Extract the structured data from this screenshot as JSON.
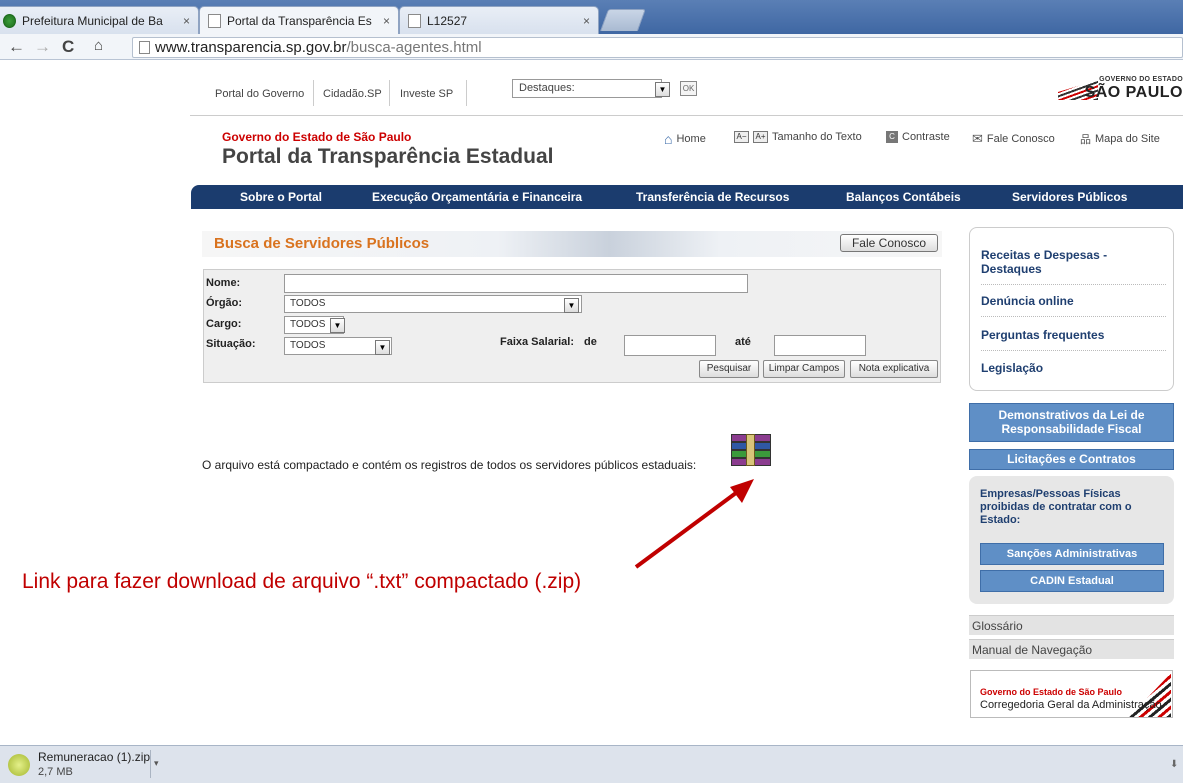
{
  "browser": {
    "tabs": [
      {
        "title": "Prefeitura Municipal de Ba",
        "close": "×"
      },
      {
        "title": "Portal da Transparência Es",
        "close": "×"
      },
      {
        "title": "L12527",
        "close": "×"
      }
    ],
    "url_host": "www.transparencia.sp.gov.br",
    "url_path": "/busca-agentes.html",
    "nav_icons": [
      "back-icon",
      "forward-icon",
      "reload-icon",
      "home-icon"
    ]
  },
  "govbar": {
    "links": [
      "Portal do Governo",
      "Cidadão.SP",
      "Investe SP"
    ],
    "destaques": "Destaques:",
    "ok_label": "OK",
    "logo_line1": "GOVERNO DO ESTADO",
    "logo_line2": "SÃO PAULO"
  },
  "header": {
    "gov_name": "Governo do Estado de São Paulo",
    "portal_name": "Portal da Transparência Estadual",
    "home": "Home",
    "a_minus": "A−",
    "a_plus": "A+",
    "text_size": "Tamanho do Texto",
    "contrast_icon": "C",
    "contrast": "Contraste",
    "contact": "Fale Conosco",
    "sitemap": "Mapa do Site"
  },
  "mainnav": [
    "Sobre o Portal",
    "Execução Orçamentária e Financeira",
    "Transferência de Recursos",
    "Balanços Contábeis",
    "Servidores Públicos"
  ],
  "search": {
    "title": "Busca de Servidores Públicos",
    "fale_button": "Fale Conosco",
    "nome_label": "Nome:",
    "nome_value": "",
    "orgao_label": "Órgão:",
    "orgao_value": "TODOS",
    "cargo_label": "Cargo:",
    "cargo_value": "TODOS",
    "situacao_label": "Situação:",
    "situacao_value": "TODOS",
    "faixa_label": "Faixa Salarial:",
    "de_label": "de",
    "ate_label": "até",
    "de_value": "",
    "ate_value": "",
    "btn_search": "Pesquisar",
    "btn_clear": "Limpar Campos",
    "btn_note": "Nota explicativa"
  },
  "download": {
    "text": "O arquivo está compactado e contém os registros de todos os servidores públicos estaduais:"
  },
  "annotation": "Link para fazer download de arquivo “.txt”  compactado (.zip)",
  "sidebar": {
    "items": [
      "Receitas e Despesas - Destaques",
      "Denúncia online",
      "Perguntas frequentes",
      "Legislação"
    ],
    "lrf": "Demonstrativos da Lei de Responsabilidade Fiscal",
    "licitacoes": "Licitações e Contratos",
    "empresas": "Empresas/Pessoas Físicas proibidas de contratar com o Estado:",
    "sancoes": "Sanções Administrativas",
    "cadin": "CADIN Estadual",
    "glossario": "Glossário",
    "manual": "Manual de Navegação",
    "corr_line1": "Governo do Estado de São Paulo",
    "corr_line2": "Corregedoria Geral da Administração"
  },
  "downloads_bar": {
    "file": "Remuneracao (1).zip",
    "size": "2,7 MB"
  }
}
